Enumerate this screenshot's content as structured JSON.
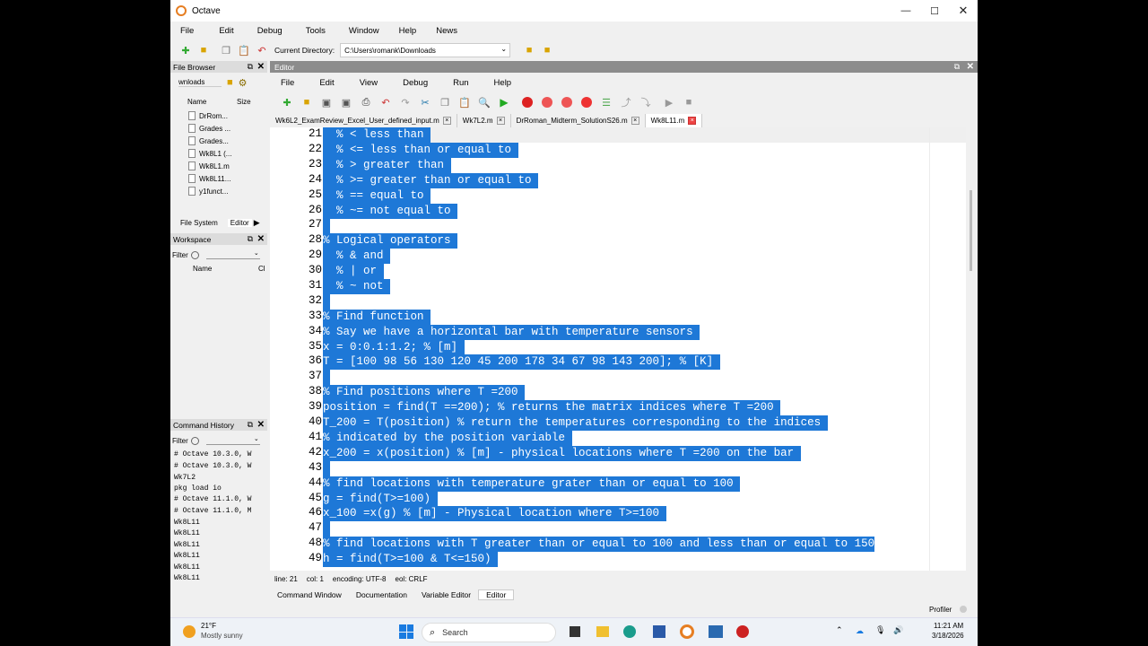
{
  "window": {
    "title": "Octave"
  },
  "menubar": [
    "File",
    "Edit",
    "Debug",
    "Tools",
    "Window",
    "Help",
    "News"
  ],
  "toolbar": {
    "current_directory_label": "Current Directory:",
    "current_directory_value": "C:\\Users\\romank\\Downloads"
  },
  "file_browser": {
    "title": "File Browser",
    "path": "wnloads",
    "col_name": "Name",
    "col_size": "Size",
    "files": [
      "DrRom...",
      "Grades ...",
      "Grades...",
      "Wk8L1 (...",
      "Wk8L1.m",
      "Wk8L11...",
      "y1funct..."
    ],
    "tab_fs": "File System",
    "tab_editor": "Editor"
  },
  "workspace": {
    "title": "Workspace",
    "filter_label": "Filter",
    "col_name": "Name",
    "col_cl": "Cl"
  },
  "command_history": {
    "title": "Command History",
    "filter_label": "Filter",
    "lines": [
      "# Octave 10.3.0, W",
      "# Octave 10.3.0, W",
      "Wk7L2",
      "pkg load io",
      "# Octave 11.1.0, W",
      "# Octave 11.1.0, M",
      "Wk8L11",
      "Wk8L11",
      "Wk8L11",
      "Wk8L11",
      "Wk8L11",
      "Wk8L11"
    ]
  },
  "editor": {
    "title": "Editor",
    "menu": [
      "File",
      "Edit",
      "View",
      "Debug",
      "Run",
      "Help"
    ],
    "tabs": [
      {
        "label": "Wk6L2_ExamReview_Excel_User_defined_input.m",
        "active": false
      },
      {
        "label": "Wk7L2.m",
        "active": false
      },
      {
        "label": "DrRoman_Midterm_SolutionS26.m",
        "active": false
      },
      {
        "label": "Wk8L11.m",
        "active": true
      }
    ],
    "lines": [
      {
        "n": "21",
        "text": "  % < less than "
      },
      {
        "n": "22",
        "text": "  % <= less than or equal to "
      },
      {
        "n": "23",
        "text": "  % > greater than "
      },
      {
        "n": "24",
        "text": "  % >= greater than or equal to "
      },
      {
        "n": "25",
        "text": "  % == equal to "
      },
      {
        "n": "26",
        "text": "  % ~= not equal to "
      },
      {
        "n": "27",
        "text": " "
      },
      {
        "n": "28",
        "text": "% Logical operators "
      },
      {
        "n": "29",
        "text": "  % & and "
      },
      {
        "n": "30",
        "text": "  % | or "
      },
      {
        "n": "31",
        "text": "  % ~ not "
      },
      {
        "n": "32",
        "text": " "
      },
      {
        "n": "33",
        "text": "% Find function "
      },
      {
        "n": "34",
        "text": "% Say we have a horizontal bar with temperature sensors "
      },
      {
        "n": "35",
        "text": "x = 0:0.1:1.2; % [m] "
      },
      {
        "n": "36",
        "text": "T = [100 98 56 130 120 45 200 178 34 67 98 143 200]; % [K] "
      },
      {
        "n": "37",
        "text": " "
      },
      {
        "n": "38",
        "text": "% Find positions where T =200 "
      },
      {
        "n": "39",
        "text": "position = find(T ==200); % returns the matrix indices where T =200 "
      },
      {
        "n": "40",
        "text": "T_200 = T(position) % return the temperatures corresponding to the indices "
      },
      {
        "n": "41",
        "text": "% indicated by the position variable "
      },
      {
        "n": "42",
        "text": "x_200 = x(position) % [m] - physical locations where T =200 on the bar "
      },
      {
        "n": "43",
        "text": " "
      },
      {
        "n": "44",
        "text": "% find locations with temperature grater than or equal to 100 "
      },
      {
        "n": "45",
        "text": "g = find(T>=100) "
      },
      {
        "n": "46",
        "text": "x_100 =x(g) % [m] - Physical location where T>=100 "
      },
      {
        "n": "47",
        "text": " "
      },
      {
        "n": "48",
        "text": "% find locations with T greater than or equal to 100 and less than or equal to 150"
      },
      {
        "n": "49",
        "text": "h = find(T>=100 & T<=150) "
      }
    ]
  },
  "status": {
    "line": "line: 21",
    "col": "col: 1",
    "encoding": "encoding: UTF-8",
    "eol": "eol: CRLF"
  },
  "bottom_tabs": [
    "Command Window",
    "Documentation",
    "Variable Editor",
    "Editor"
  ],
  "profiler": "Profiler",
  "taskbar": {
    "weather_temp": "21°F",
    "weather_desc": "Mostly sunny",
    "search": "Search",
    "time": "11:21 AM",
    "date": "3/18/2026"
  },
  "colors": {
    "selection": "#1e78d7",
    "panel_title": "#dcdcdc",
    "editor_title": "#8c8c8c"
  }
}
